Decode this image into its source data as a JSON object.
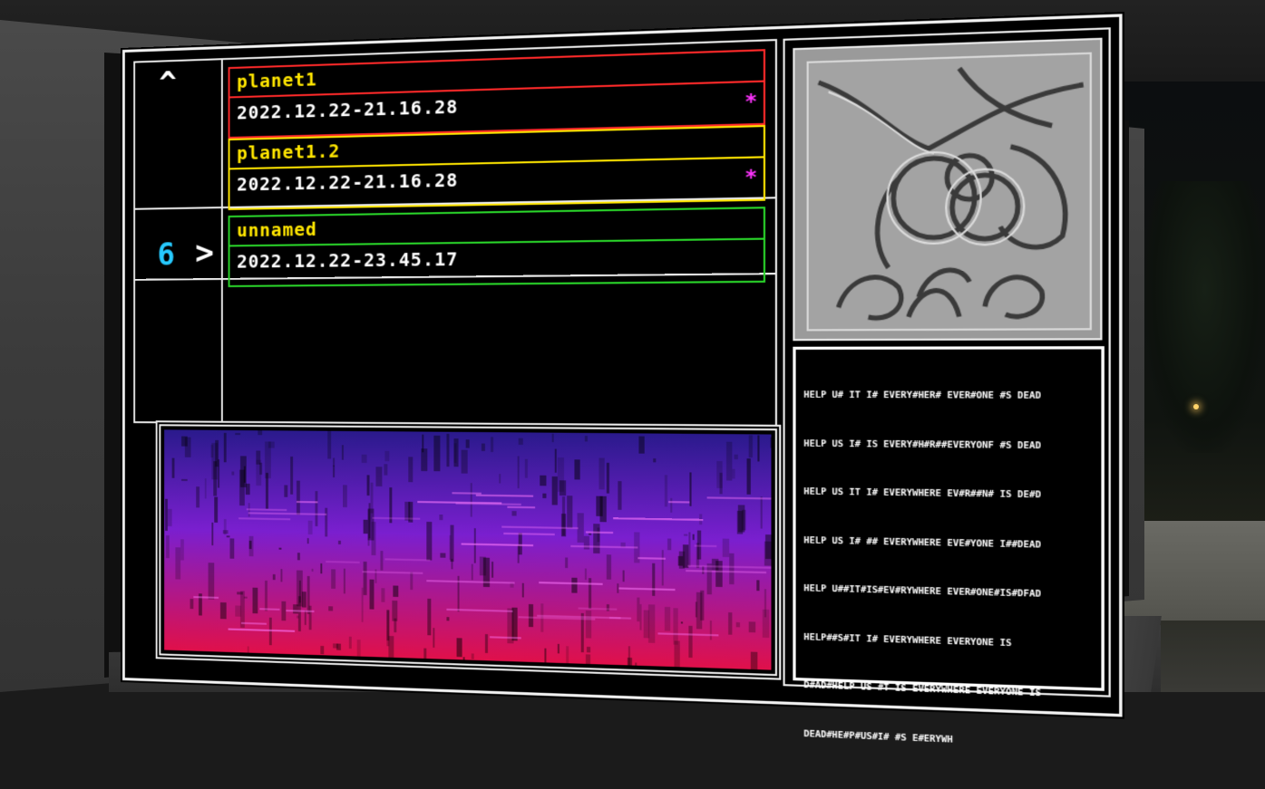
{
  "nav": {
    "up_glyph": "^",
    "slot_number": "6",
    "slot_arrow": ">"
  },
  "saves": [
    {
      "name": "planet1",
      "date": "2022.12.22-21.16.28",
      "marker": "*",
      "color": "#ff2a2a"
    },
    {
      "name": "planet1.2",
      "date": "2022.12.22-21.16.28",
      "marker": "*",
      "color": "#ffe600"
    },
    {
      "name": "unnamed",
      "date": "2022.12.22-23.45.17",
      "color": "#2ad62a"
    }
  ],
  "colors": {
    "name_text": "#ffe600",
    "marker": "#ff33ff",
    "slot_number": "#26c9ff",
    "frame": "#eaeaea"
  },
  "spectrogram": {
    "top_color": "#2a1a8c",
    "mid_color": "#7a1fcf",
    "bottom_color": "#e0104a"
  },
  "log_lines": [
    "HELP U# IT I# EVERY#HER# EVER#ONE #S DEAD",
    "HELP US I# IS EVERY#H#R##EVERYONF #S DEAD",
    "HELP US IT I# EVERYWHERE EV#R##N# IS DE#D",
    "HELP US I# ## EVERYWHERE EVE#YONE I##DEAD",
    "HELP U##IT#IS#EV#RYWHERE EVER#ONE#IS#DFAD",
    "HELP##S#IT I# EVERYWHERE EVERYONE IS",
    "D#AD#HELP US #T IS EVERYWHERE EVERYONE IS",
    "DEAD#HE#P#US#I# #S E#ERYWH"
  ]
}
